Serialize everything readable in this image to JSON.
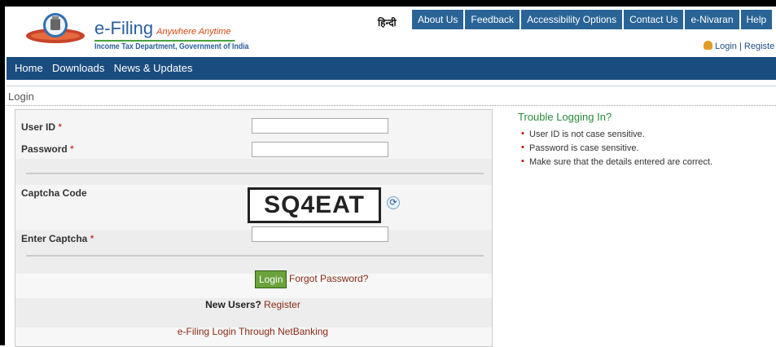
{
  "header": {
    "brand_title": "e-Filing",
    "brand_tagline": "Anywhere Anytime",
    "brand_subtitle": "Income Tax Department, Government of India",
    "hindi_link": "हिन्दी",
    "top_nav": [
      "About Us",
      "Feedback",
      "Accessibility Options",
      "Contact Us",
      "e-Nivaran",
      "Help"
    ],
    "login_label": "Login",
    "register_label": "Registe",
    "login_separator": " | "
  },
  "main_nav": [
    "Home",
    "Downloads",
    "News & Updates"
  ],
  "page_title": "Login",
  "form": {
    "user_id_label": "User ID",
    "password_label": "Password",
    "captcha_code_label": "Captcha Code",
    "captcha_value": "SQ4EAT",
    "enter_captcha_label": "Enter Captcha",
    "required_mark": "*",
    "login_button": "Login",
    "forgot_password": "Forgot Password?",
    "new_users_label": "New Users?",
    "register_link": "Register",
    "netbanking_link": "e-Filing Login Through NetBanking"
  },
  "trouble": {
    "title": "Trouble Logging In?",
    "tips": [
      "User ID is not case sensitive.",
      "Password is case sensitive.",
      "Make sure that the details entered are correct."
    ]
  },
  "colors": {
    "nav_blue": "#1a4c7f",
    "topnav_blue": "#2a6496",
    "login_green": "#6aa33b",
    "link_red": "#8a2a14",
    "accent_orange": "#d84a12"
  }
}
